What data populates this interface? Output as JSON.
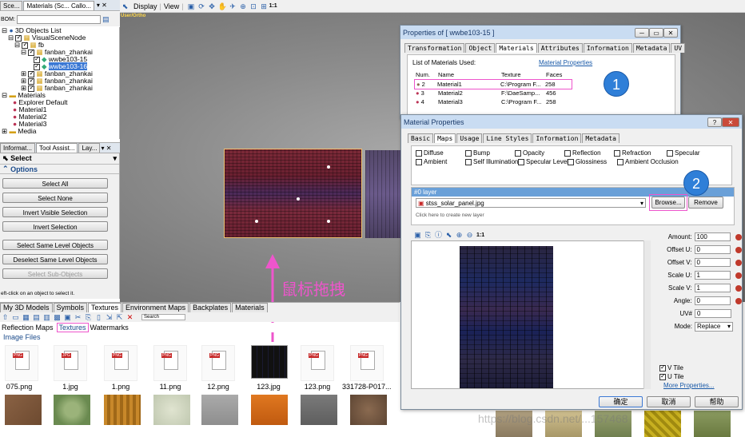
{
  "tabs_top": [
    "Sce...",
    "Materials (Sc... Callo..."
  ],
  "toolbar": {
    "display": "Display",
    "view": "View",
    "zoom": "1:1"
  },
  "bom_label": "BOM:",
  "viewport_label": "User/Ortho",
  "tree": {
    "items": [
      "3D Objects List",
      "VisualSceneNode",
      "fb",
      "fanban_zhankai",
      "wwbe103-15",
      "wwbe103-16",
      "fanban_zhankai",
      "fanban_zhankai",
      "fanban_zhankai",
      "Materials",
      "Explorer Default",
      "Material1",
      "Material2",
      "Material3",
      "Media"
    ]
  },
  "panel_tabs": [
    "Informat...",
    "Tool Assist...",
    "Lay..."
  ],
  "select_header": "Select",
  "options_header": "Options",
  "buttons": {
    "select_all": "Select All",
    "select_none": "Select None",
    "invert_visible": "Invert Visible Selection",
    "invert_selection": "Invert Selection",
    "select_same": "Select Same Level Objects",
    "deselect_same": "Deselect Same Level Objects",
    "select_sub": "Select Sub-Objects"
  },
  "status_text": "eft-click on an object to select it.",
  "bottom_tabs": [
    "My 3D Models",
    "Symbols",
    "Textures",
    "Environment Maps",
    "Backplates",
    "Materials"
  ],
  "search_label": "Search",
  "sub_tabs": [
    "Reflection Maps",
    "Textures",
    "Watermarks"
  ],
  "image_files_label": "Image Files",
  "files": [
    "075.png",
    "1.jpg",
    "1.png",
    "11.png",
    "12.png",
    "123.jpg",
    "123.png",
    "331728-P017..."
  ],
  "annotation_cn": "鼠标拖拽",
  "props": {
    "title": "Properties of  [ wwbe103-15 ]",
    "tabs": [
      "Transformation",
      "Object",
      "Materials",
      "Attributes",
      "Information",
      "Metadata",
      "UV"
    ],
    "list_label": "List of Materials Used:",
    "link": "Material Properties",
    "headers": [
      "Num.",
      "Name",
      "Texture",
      "Faces"
    ],
    "rows": [
      {
        "num": "2",
        "name": "Material1",
        "texture": "C:\\Program F...",
        "faces": "258"
      },
      {
        "num": "3",
        "name": "Material2",
        "texture": "F:\\DaeSamp...",
        "faces": "456"
      },
      {
        "num": "4",
        "name": "Material3",
        "texture": "C:\\Program F...",
        "faces": "258"
      }
    ],
    "badge1": "1"
  },
  "mat": {
    "title": "Material Properties",
    "tabs": [
      "Basic",
      "Maps",
      "Usage",
      "Line Styles",
      "Information",
      "Metadata"
    ],
    "maps": [
      [
        "Diffuse",
        "Bump",
        "Opacity",
        "Reflection",
        "Refraction",
        "Specular"
      ],
      [
        "Ambient",
        "Self Illumination",
        "Specular Level",
        "Glossiness",
        "Ambient Occlusion"
      ]
    ],
    "layer_label": "#0 layer",
    "layer_file": "stss_solar_panel.jpg",
    "browse": "Browse...",
    "remove": "Remove",
    "new_layer": "Click here to create new layer",
    "badge2": "2",
    "zoom": "1:1",
    "amount_label": "Amount:",
    "amount": "100",
    "offset_u_label": "Offset U:",
    "offset_u": "0",
    "offset_v_label": "Offset V:",
    "offset_v": "0",
    "scale_u_label": "Scale U:",
    "scale_u": "1",
    "scale_v_label": "Scale V:",
    "scale_v": "1",
    "angle_label": "Angle:",
    "angle": "0",
    "uv_label": "UV#",
    "uv": "0",
    "mode_label": "Mode:",
    "mode": "Replace",
    "v_tile": "V Tile",
    "u_tile": "U Tile",
    "more": "More Properties...",
    "ok": "确定",
    "cancel": "取消",
    "help": "帮助"
  },
  "watermark": "https://blog.csdn.net/...157468",
  "colors": {
    "accent_pink": "#ee55cc",
    "badge_blue": "#2f7fd8",
    "dialog_title_bg": "#c9dcf2",
    "layer_bar": "#6aa0d8"
  }
}
